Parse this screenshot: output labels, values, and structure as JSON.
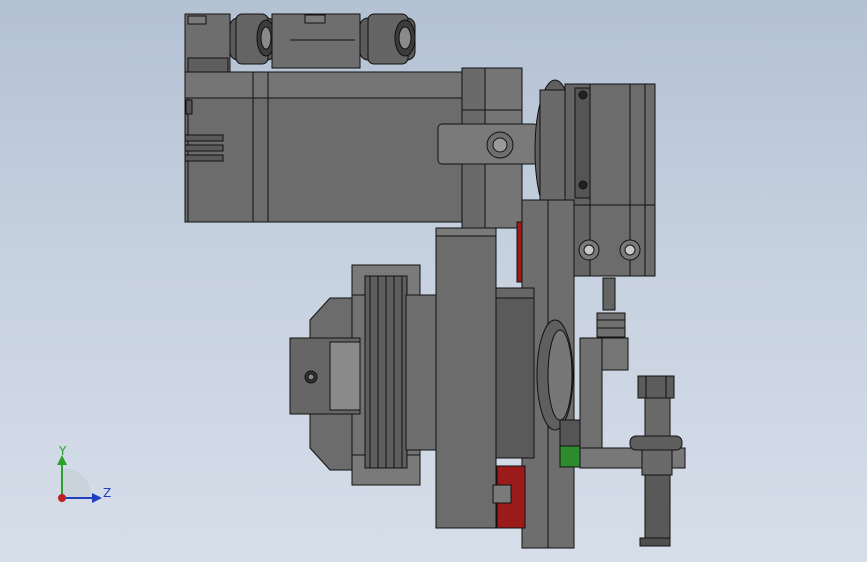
{
  "viewport": {
    "background_top": "#b4c1d3",
    "background_bottom": "#d6dee9"
  },
  "model": {
    "part_color": "#6c6c6c",
    "part_color_dark": "#4a4a4a",
    "part_color_light": "#8a8a8a",
    "edge_color": "#111111",
    "accent_red": "#9b1b1b",
    "accent_green": "#2e8b2e"
  },
  "triad": {
    "y_label": "Y",
    "z_label": "Z",
    "y_axis_color": "#2aa12a",
    "z_axis_color": "#1f3fbf",
    "x_axis_color": "#c01f1f",
    "y_arrow_icon": "arrow-up-icon",
    "z_arrow_icon": "arrow-right-icon"
  }
}
